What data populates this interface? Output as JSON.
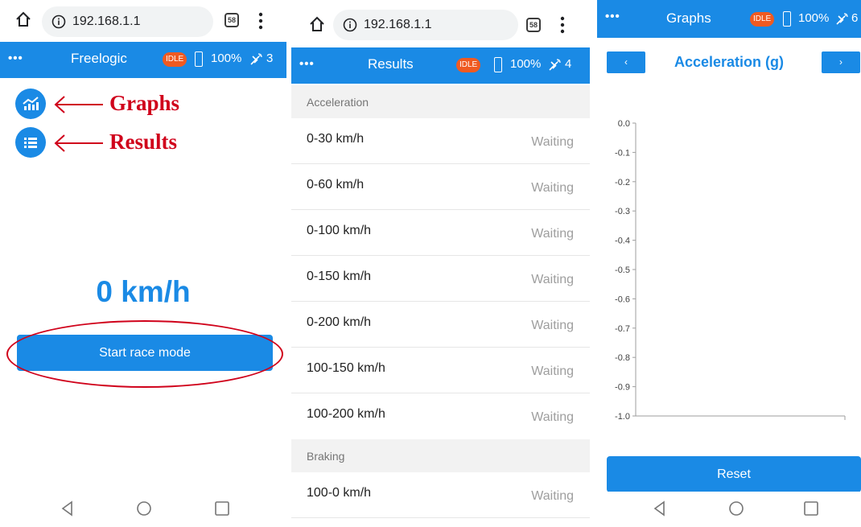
{
  "browser": {
    "url": "192.168.1.1",
    "tab_count": "58"
  },
  "status": {
    "idle_badge": "IDLE",
    "battery": "100%"
  },
  "screen_freelogic": {
    "title": "Freelogic",
    "satellites": "3",
    "annotation_graphs": "Graphs",
    "annotation_results": "Results",
    "speed": "0 km/h",
    "start_button": "Start race mode"
  },
  "screen_results": {
    "title": "Results",
    "satellites": "4",
    "sections": [
      {
        "title": "Acceleration",
        "rows": [
          {
            "label": "0-30 km/h",
            "status": "Waiting"
          },
          {
            "label": "0-60 km/h",
            "status": "Waiting"
          },
          {
            "label": "0-100 km/h",
            "status": "Waiting"
          },
          {
            "label": "0-150 km/h",
            "status": "Waiting"
          },
          {
            "label": "0-200 km/h",
            "status": "Waiting"
          },
          {
            "label": "100-150 km/h",
            "status": "Waiting"
          },
          {
            "label": "100-200 km/h",
            "status": "Waiting"
          }
        ]
      },
      {
        "title": "Braking",
        "rows": [
          {
            "label": "100-0 km/h",
            "status": "Waiting"
          }
        ]
      }
    ]
  },
  "screen_graphs": {
    "title": "Graphs",
    "satellites": "6",
    "prev_button": "‹",
    "next_button": "›",
    "graph_title": "Acceleration (g)",
    "reset_button": "Reset"
  },
  "chart_data": {
    "type": "line",
    "title": "Acceleration (g)",
    "y_ticks": [
      "0.0",
      "-0.1",
      "-0.2",
      "-0.3",
      "-0.4",
      "-0.5",
      "-0.6",
      "-0.7",
      "-0.8",
      "-0.9",
      "-1.0"
    ],
    "ylim": [
      -1.0,
      0.0
    ],
    "series": [],
    "grid": false
  },
  "colors": {
    "primary": "#1a8ae5",
    "idle_badge": "#ef5a21",
    "annotation": "#d0021b"
  },
  "icons": {
    "graphs": "chart-trend-icon",
    "results": "list-icon",
    "home": "home-icon",
    "info": "info-icon",
    "satellite": "satellite-icon",
    "battery": "battery-icon",
    "menu": "more-dots-icon",
    "back": "nav-back-icon",
    "home_nav": "nav-home-icon",
    "recents": "nav-recents-icon"
  }
}
